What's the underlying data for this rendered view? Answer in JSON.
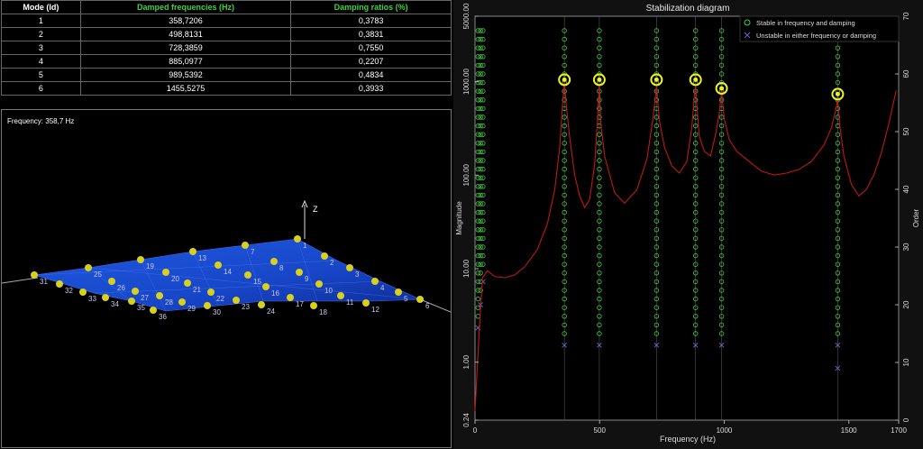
{
  "modal_table": {
    "headers": [
      "Mode (Id)",
      "Damped frequencies (Hz)",
      "Damping ratios (%)"
    ],
    "rows": [
      [
        "1",
        "358,7206",
        "0,3783"
      ],
      [
        "2",
        "498,8131",
        "0,3831"
      ],
      [
        "3",
        "728,3859",
        "0,7550"
      ],
      [
        "4",
        "885,0977",
        "0,2207"
      ],
      [
        "5",
        "989,5392",
        "0,4834"
      ],
      [
        "6",
        "1455,5275",
        "0,3933"
      ]
    ]
  },
  "mode_view": {
    "frequency_label": "Frequency: 358,7 Hz",
    "axis_label": "Z",
    "node_ids": [
      "1",
      "2",
      "3",
      "4",
      "5",
      "6",
      "7",
      "8",
      "9",
      "10",
      "11",
      "12",
      "13",
      "14",
      "15",
      "16",
      "17",
      "18",
      "19",
      "20",
      "21",
      "22",
      "23",
      "24",
      "25",
      "26",
      "27",
      "28",
      "29",
      "30",
      "31",
      "32",
      "33",
      "34",
      "35",
      "36"
    ],
    "colors": {
      "mesh": "#1846c8",
      "node": "#d8d020",
      "line": "#aaaaaa"
    }
  },
  "stabilization": {
    "title": "Stabilization diagram",
    "legend": {
      "stable": "Stable in frequency and damping",
      "unstable": "Unstable in either frequency or damping"
    },
    "colors": {
      "stable": "#40d040",
      "unstable": "#6a6acc",
      "curve": "#c01818",
      "selected": "#f0f020",
      "background": "#000000"
    }
  },
  "chart_data": {
    "type": "line",
    "title": "Stabilization diagram",
    "xlabel": "Frequency (Hz)",
    "ylabel": "Magnitude",
    "y2label": "Order",
    "xlim": [
      0,
      1700
    ],
    "ylim": [
      0.24,
      5000
    ],
    "y2lim": [
      0,
      70
    ],
    "yscale": "log",
    "x_ticks": [
      "0",
      "500",
      "1000",
      "1500",
      "1700"
    ],
    "y_ticks": [
      "0.24",
      "1.00",
      "10.00",
      "100.00",
      "1000.00",
      "5000.00"
    ],
    "y2_ticks": [
      "0",
      "10",
      "20",
      "30",
      "40",
      "50",
      "60",
      "70"
    ],
    "legend_placement": "top-right",
    "selected_modes_hz": [
      358.72,
      498.81,
      728.39,
      885.1,
      989.54,
      1455.53
    ],
    "stable_columns_hz": [
      12,
      22,
      32,
      358.72,
      498.81,
      728.39,
      885.1,
      989.54,
      1455.53
    ],
    "frf_curve": {
      "x": [
        0,
        10,
        20,
        30,
        50,
        80,
        120,
        160,
        200,
        250,
        290,
        320,
        340,
        352,
        358.7,
        365,
        380,
        400,
        420,
        440,
        460,
        480,
        492,
        498.8,
        505,
        520,
        560,
        600,
        650,
        690,
        715,
        728.4,
        740,
        760,
        790,
        820,
        850,
        870,
        880,
        885.1,
        890,
        900,
        920,
        945,
        965,
        980,
        989.5,
        1000,
        1020,
        1050,
        1100,
        1150,
        1200,
        1250,
        1300,
        1350,
        1400,
        1430,
        1448,
        1455.5,
        1465,
        1480,
        1510,
        1540,
        1570,
        1600,
        1630,
        1660,
        1690
      ],
      "y": [
        0.3,
        1.0,
        3.0,
        8.0,
        9.5,
        8.2,
        8.0,
        8.6,
        10.5,
        16,
        30,
        70,
        200,
        600,
        1000,
        600,
        250,
        100,
        60,
        45,
        55,
        130,
        400,
        950,
        350,
        160,
        65,
        50,
        70,
        150,
        420,
        900,
        380,
        200,
        125,
        105,
        140,
        320,
        700,
        900,
        560,
        260,
        180,
        160,
        270,
        450,
        800,
        400,
        240,
        180,
        140,
        110,
        100,
        105,
        115,
        140,
        210,
        320,
        500,
        650,
        320,
        160,
        80,
        60,
        70,
        100,
        170,
        350,
        800
      ]
    }
  }
}
